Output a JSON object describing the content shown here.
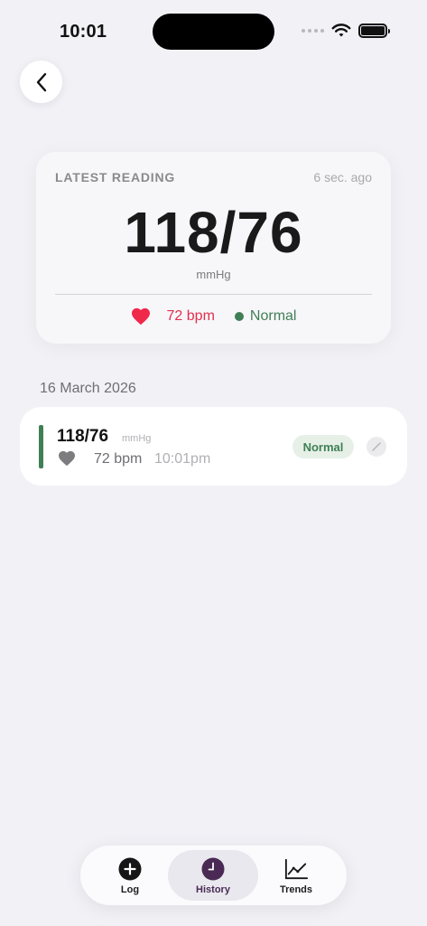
{
  "status_bar": {
    "time": "10:01"
  },
  "latest": {
    "label": "LATEST READING",
    "time_ago": "6 sec. ago",
    "value": "118/76",
    "unit": "mmHg",
    "bpm": "72 bpm",
    "status": "Normal"
  },
  "history": {
    "date": "16 March 2026",
    "entries": [
      {
        "value": "118/76",
        "unit": "mmHg",
        "bpm": "72 bpm",
        "time": "10:01pm",
        "status": "Normal"
      }
    ]
  },
  "tabs": [
    {
      "label": "Log",
      "icon": "plus-circle-icon"
    },
    {
      "label": "History",
      "icon": "clock-icon"
    },
    {
      "label": "Trends",
      "icon": "chart-icon"
    }
  ],
  "colors": {
    "normal": "#3f7f55",
    "heart": "#e0304e",
    "history_accent": "#4a2a55"
  }
}
